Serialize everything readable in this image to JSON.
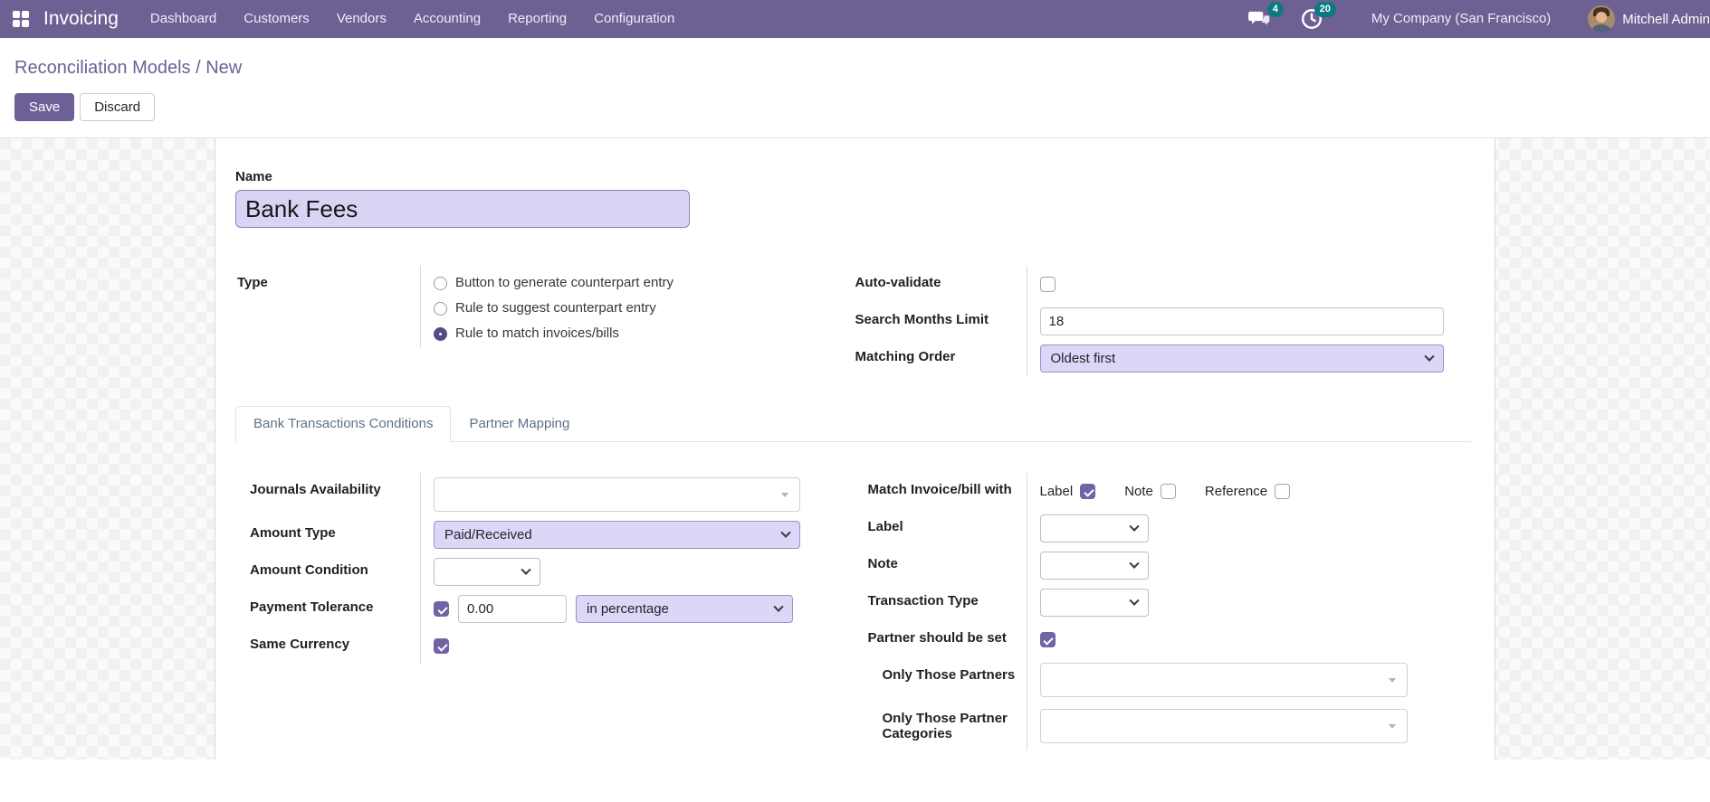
{
  "navbar": {
    "brand": "Invoicing",
    "menus": [
      "Dashboard",
      "Customers",
      "Vendors",
      "Accounting",
      "Reporting",
      "Configuration"
    ],
    "messages_badge": "4",
    "activities_badge": "20",
    "company": "My Company (San Francisco)",
    "user": "Mitchell Admin",
    "colors": {
      "bg": "#6d6194",
      "badge": "#0c7b81"
    }
  },
  "control_panel": {
    "breadcrumb": "Reconciliation Models / New",
    "save_label": "Save",
    "discard_label": "Discard"
  },
  "form": {
    "name": {
      "label": "Name",
      "value": "Bank Fees"
    },
    "type": {
      "label": "Type",
      "options": [
        {
          "label": "Button to generate counterpart entry",
          "selected": false
        },
        {
          "label": "Rule to suggest counterpart entry",
          "selected": false
        },
        {
          "label": "Rule to match invoices/bills",
          "selected": true
        }
      ]
    },
    "auto_validate": {
      "label": "Auto-validate",
      "checked": false
    },
    "search_months_limit": {
      "label": "Search Months Limit",
      "value": "18"
    },
    "matching_order": {
      "label": "Matching Order",
      "value": "Oldest first"
    },
    "tabs": [
      {
        "label": "Bank Transactions Conditions",
        "active": true
      },
      {
        "label": "Partner Mapping",
        "active": false
      }
    ],
    "conditions": {
      "journals_availability": {
        "label": "Journals Availability",
        "value": ""
      },
      "amount_type": {
        "label": "Amount Type",
        "value": "Paid/Received"
      },
      "amount_condition": {
        "label": "Amount Condition",
        "value": ""
      },
      "payment_tolerance": {
        "label": "Payment Tolerance",
        "checked": true,
        "amount": "0.00",
        "mode": "in percentage"
      },
      "same_currency": {
        "label": "Same Currency",
        "checked": true
      },
      "match_invoice_bill": {
        "label": "Match Invoice/bill with",
        "items": [
          {
            "label": "Label",
            "checked": true
          },
          {
            "label": "Note",
            "checked": false
          },
          {
            "label": "Reference",
            "checked": false
          }
        ]
      },
      "label_field": {
        "label": "Label",
        "value": ""
      },
      "note_field": {
        "label": "Note",
        "value": ""
      },
      "transaction_type": {
        "label": "Transaction Type",
        "value": ""
      },
      "partner_should_be_set": {
        "label": "Partner should be set",
        "checked": true
      },
      "only_those_partners": {
        "label": "Only Those Partners",
        "value": ""
      },
      "only_those_partner_categories": {
        "label": "Only Those Partner Categories",
        "value": ""
      }
    },
    "colors": {
      "accent": "#6d6096",
      "checkbox": "#7163a6",
      "radio": "#554a85",
      "select_bg": "#dcd7f6"
    }
  }
}
